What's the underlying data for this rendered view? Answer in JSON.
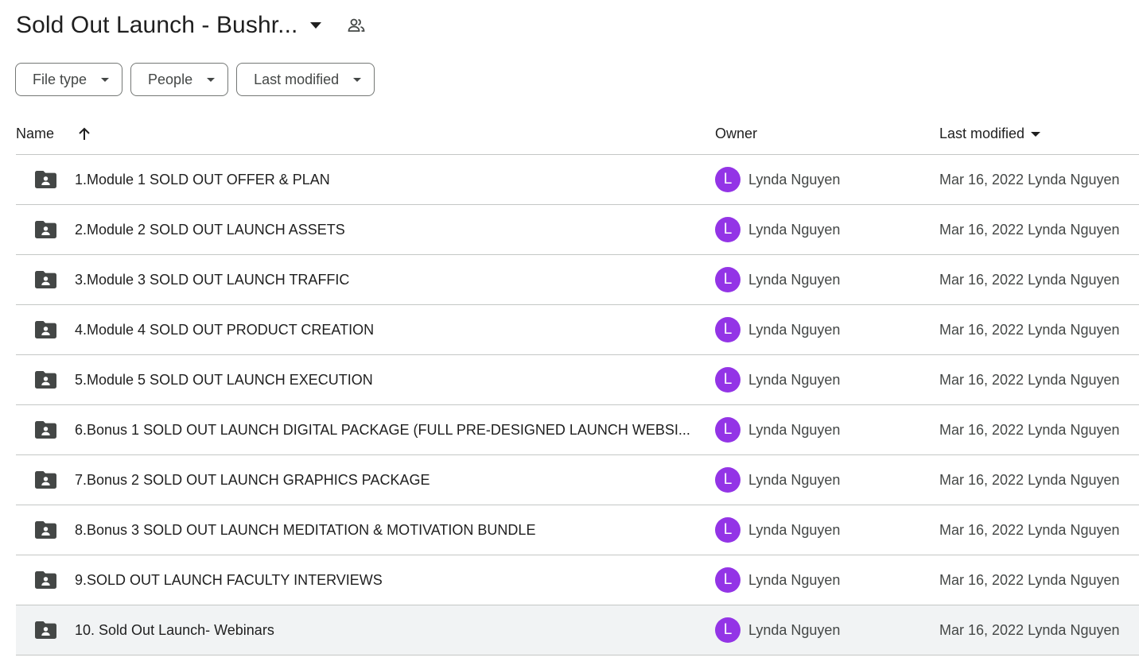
{
  "header": {
    "title": "Sold Out Launch - Bushr...",
    "caret_icon": "arrow-drop-down-icon",
    "shared_icon": "people-icon"
  },
  "filters": [
    {
      "label": "File type"
    },
    {
      "label": "People"
    },
    {
      "label": "Last modified"
    }
  ],
  "columns": {
    "name": "Name",
    "owner": "Owner",
    "last_modified": "Last modified",
    "name_sort_icon": "arrow-upward-icon"
  },
  "colors": {
    "avatar": "#9334e6",
    "selected_row": "#f1f3f4",
    "folder_icon": "#444746"
  },
  "rows": [
    {
      "name": "1.Module 1 SOLD OUT OFFER & PLAN",
      "owner_initial": "L",
      "owner": "Lynda Nguyen",
      "modified": "Mar 16, 2022 Lynda Nguyen"
    },
    {
      "name": "2.Module 2 SOLD OUT LAUNCH ASSETS",
      "owner_initial": "L",
      "owner": "Lynda Nguyen",
      "modified": "Mar 16, 2022 Lynda Nguyen"
    },
    {
      "name": "3.Module 3 SOLD OUT LAUNCH TRAFFIC",
      "owner_initial": "L",
      "owner": "Lynda Nguyen",
      "modified": "Mar 16, 2022 Lynda Nguyen"
    },
    {
      "name": "4.Module 4 SOLD OUT PRODUCT CREATION",
      "owner_initial": "L",
      "owner": "Lynda Nguyen",
      "modified": "Mar 16, 2022 Lynda Nguyen"
    },
    {
      "name": "5.Module 5 SOLD OUT LAUNCH EXECUTION",
      "owner_initial": "L",
      "owner": "Lynda Nguyen",
      "modified": "Mar 16, 2022 Lynda Nguyen"
    },
    {
      "name": "6.Bonus 1 SOLD OUT LAUNCH DIGITAL PACKAGE (FULL PRE-DESIGNED LAUNCH WEBSI...",
      "owner_initial": "L",
      "owner": "Lynda Nguyen",
      "modified": "Mar 16, 2022 Lynda Nguyen"
    },
    {
      "name": "7.Bonus 2 SOLD OUT LAUNCH GRAPHICS PACKAGE",
      "owner_initial": "L",
      "owner": "Lynda Nguyen",
      "modified": "Mar 16, 2022 Lynda Nguyen"
    },
    {
      "name": "8.Bonus 3 SOLD OUT LAUNCH MEDITATION & MOTIVATION BUNDLE",
      "owner_initial": "L",
      "owner": "Lynda Nguyen",
      "modified": "Mar 16, 2022 Lynda Nguyen"
    },
    {
      "name": "9.SOLD OUT LAUNCH FACULTY INTERVIEWS",
      "owner_initial": "L",
      "owner": "Lynda Nguyen",
      "modified": "Mar 16, 2022 Lynda Nguyen"
    },
    {
      "name": "10. Sold Out Launch- Webinars",
      "owner_initial": "L",
      "owner": "Lynda Nguyen",
      "modified": "Mar 16, 2022 Lynda Nguyen"
    }
  ]
}
